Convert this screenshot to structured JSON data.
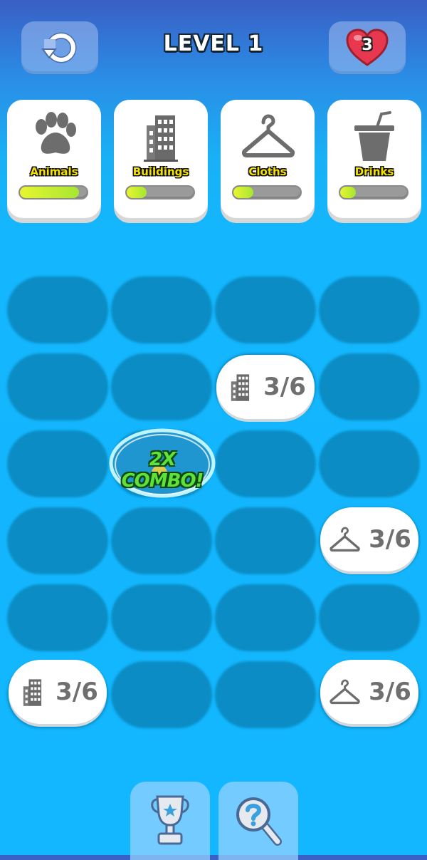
{
  "header": {
    "level_title": "LEVEL 1",
    "lives": "3",
    "restart_icon": "restart-icon",
    "heart_icon": "heart-icon"
  },
  "categories": [
    {
      "label": "Animals",
      "icon": "paw-icon",
      "progress": 0.88
    },
    {
      "label": "Buildings",
      "icon": "building-icon",
      "progress": 0.3
    },
    {
      "label": "Cloths",
      "icon": "hanger-icon",
      "progress": 0.3
    },
    {
      "label": "Drinks",
      "icon": "cup-icon",
      "progress": 0.23
    }
  ],
  "board": {
    "tiles": [
      {
        "icon": "building-icon",
        "text": "3/6"
      },
      {
        "icon": "hanger-icon",
        "text": "3/6"
      },
      {
        "icon": "building-icon",
        "text": "3/6"
      },
      {
        "icon": "hanger-icon",
        "text": "3/6"
      }
    ],
    "combo_text": "2X COMBO!"
  },
  "bottom": {
    "trophy_icon": "trophy-icon",
    "hint_icon": "magnifier-hint-icon"
  },
  "colors": {
    "accent_yellow": "#f6e200",
    "progress_green": "#a6e632",
    "slot_blue": "#0b8cc4",
    "combo_green": "#5fe03a",
    "heart_red": "#e8384f"
  }
}
